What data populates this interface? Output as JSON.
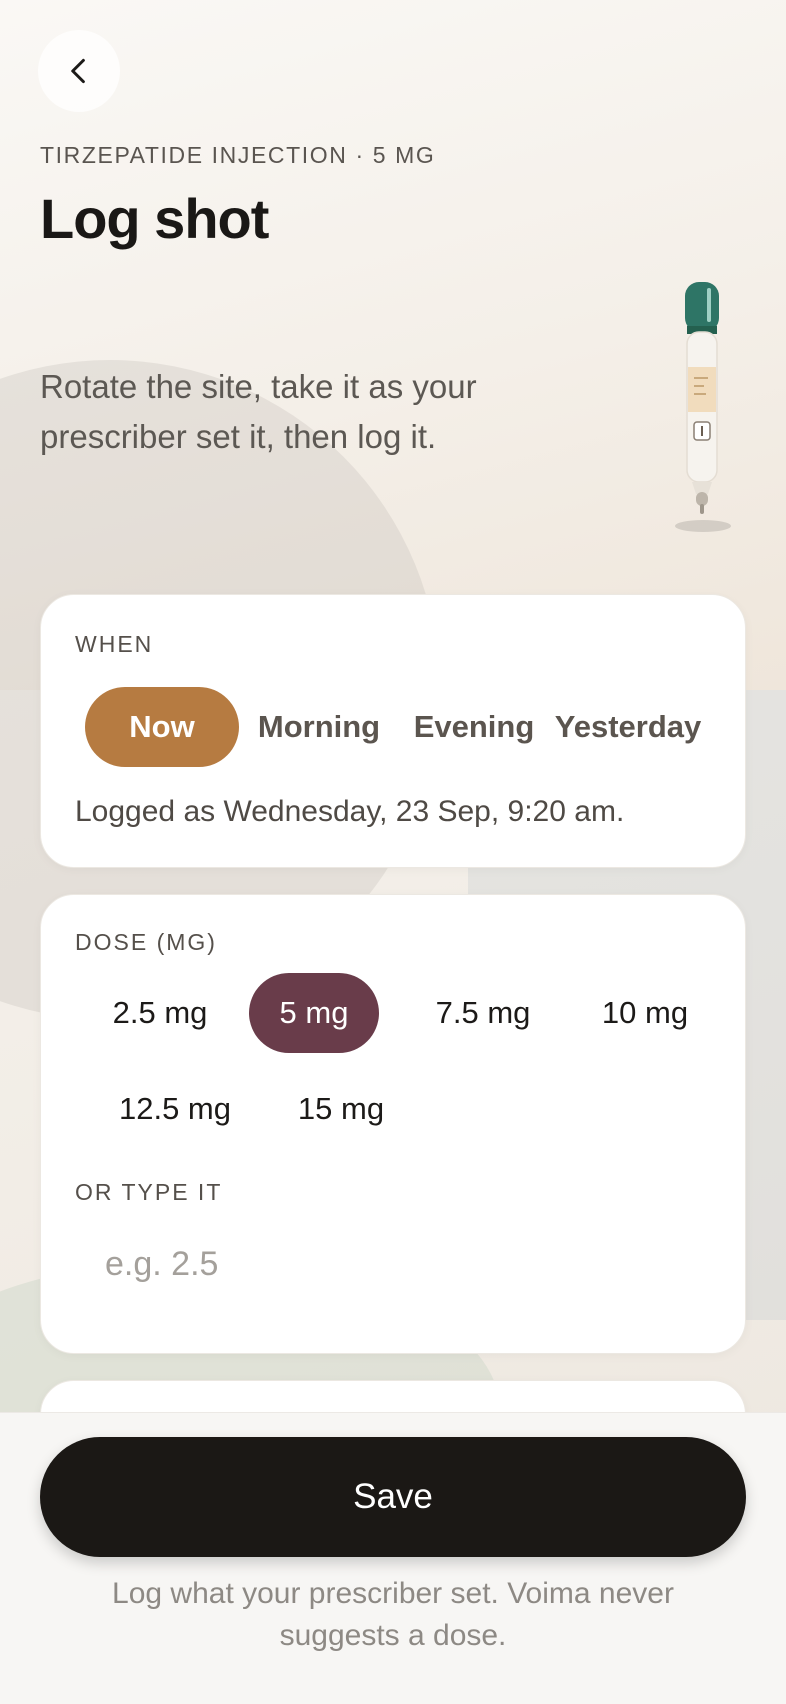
{
  "header": {
    "back_label": "",
    "eyebrow": "TIRZEPATIDE INJECTION · 5 MG",
    "title": "Log shot",
    "intro": "Rotate the site, take it as your prescriber set it, then log it."
  },
  "when": {
    "label": "WHEN",
    "options": [
      "Now",
      "Morning",
      "Evening",
      "Yesterday"
    ],
    "selected": "Now",
    "logged_as": "Logged as Wednesday, 23 Sep, 9:20 am."
  },
  "dose": {
    "label": "DOSE (MG)",
    "options": [
      "2.5 mg",
      "5 mg",
      "7.5 mg",
      "10 mg",
      "12.5 mg",
      "15 mg"
    ],
    "selected": "5 mg",
    "type_label": "OR TYPE IT",
    "input_placeholder": "e.g. 2.5",
    "input_value": ""
  },
  "footer": {
    "save_label": "Save",
    "disclaimer": "Log what your prescriber set. Voima never suggests a dose."
  },
  "colors": {
    "when_selected": "#b67b41",
    "dose_selected": "#693c4a",
    "save_button": "#1b1815",
    "pen_cap": "#2e7566"
  },
  "icons": {
    "back": "chevron-left-icon",
    "pen": "injection-pen-illustration"
  }
}
